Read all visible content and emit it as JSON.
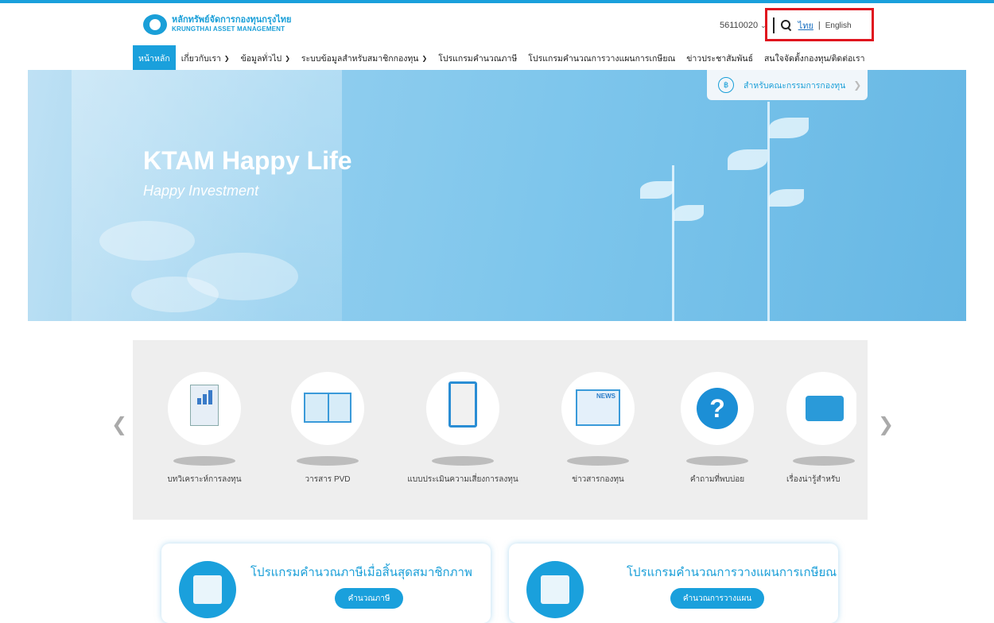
{
  "header": {
    "logo_th": "หลักทรัพย์จัดการกองทุนกรุงไทย",
    "logo_en": "KRUNGTHAI ASSET MANAGEMENT",
    "user_code": "56110020",
    "lang_th": "ไทย",
    "lang_sep": "|",
    "lang_en": "English"
  },
  "nav": {
    "items": [
      {
        "label": "หน้าหลัก"
      },
      {
        "label": "เกี่ยวกับเรา"
      },
      {
        "label": "ข้อมูลทั่วไป"
      },
      {
        "label": "ระบบข้อมูลสำหรับสมาชิกกองทุน"
      },
      {
        "label": "โปรแกรมคำนวณภาษี"
      },
      {
        "label": "โปรแกรมคำนวณการวางแผนการเกษียณ"
      },
      {
        "label": "ข่าวประชาสัมพันธ์"
      },
      {
        "label": "สนใจจัดตั้งกองทุน/ติดต่อเรา"
      }
    ]
  },
  "hero": {
    "title": "KTAM Happy Life",
    "subtitle": "Happy Investment",
    "committee_label": "สำหรับคณะกรรมการกองทุน"
  },
  "carousel": {
    "items": [
      {
        "label": "บทวิเคราะห์การลงทุน"
      },
      {
        "label": "วารสาร PVD"
      },
      {
        "label": "แบบประเมินความเสี่ยงการลงทุน"
      },
      {
        "label": "ข่าวสารกองทุน"
      },
      {
        "label": "คำถามที่พบบ่อย"
      },
      {
        "label": "เรื่องน่ารู้สำหรับ"
      }
    ],
    "news_tag": "NEWS",
    "question_mark": "?"
  },
  "cards": [
    {
      "title": "โปรแกรมคำนวณภาษีเมื่อสิ้นสุดสมาชิกภาพ",
      "button": "คำนวณภาษี"
    },
    {
      "title": "โปรแกรมคำนวณการวางแผนการเกษียณ",
      "button": "คำนวณการวางแผน"
    }
  ],
  "colors": {
    "accent": "#1aa0dc",
    "highlight": "#e0141e"
  }
}
